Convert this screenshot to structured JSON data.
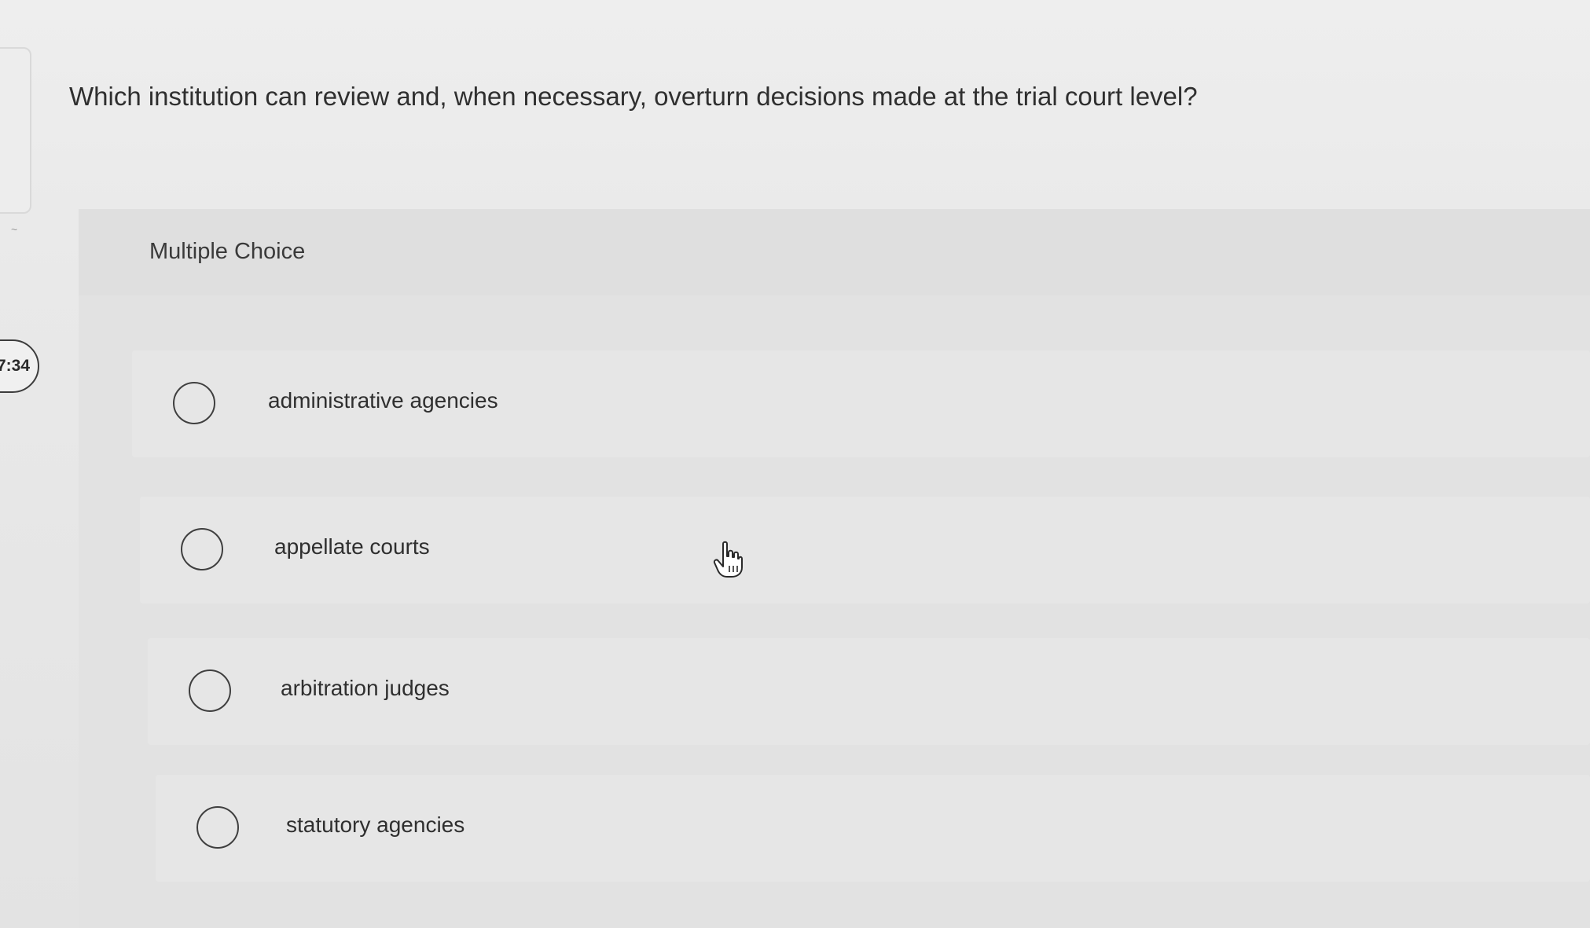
{
  "timer": {
    "text": "7:34"
  },
  "question": {
    "text": "Which institution can review and, when necessary, overturn decisions made at the trial court level?"
  },
  "question_type": {
    "label": "Multiple Choice"
  },
  "options": [
    {
      "label": "administrative agencies",
      "selected": false
    },
    {
      "label": "appellate courts",
      "selected": false
    },
    {
      "label": "arbitration judges",
      "selected": false
    },
    {
      "label": "statutory agencies",
      "selected": false
    }
  ],
  "colors": {
    "background": "#e9e9e9",
    "panel": "#e2e2e2",
    "text": "#2f2f2f",
    "radio_border": "#3f3f3f"
  },
  "icons": {
    "radio": "radio-button-icon",
    "cursor": "hand-pointer-icon"
  }
}
